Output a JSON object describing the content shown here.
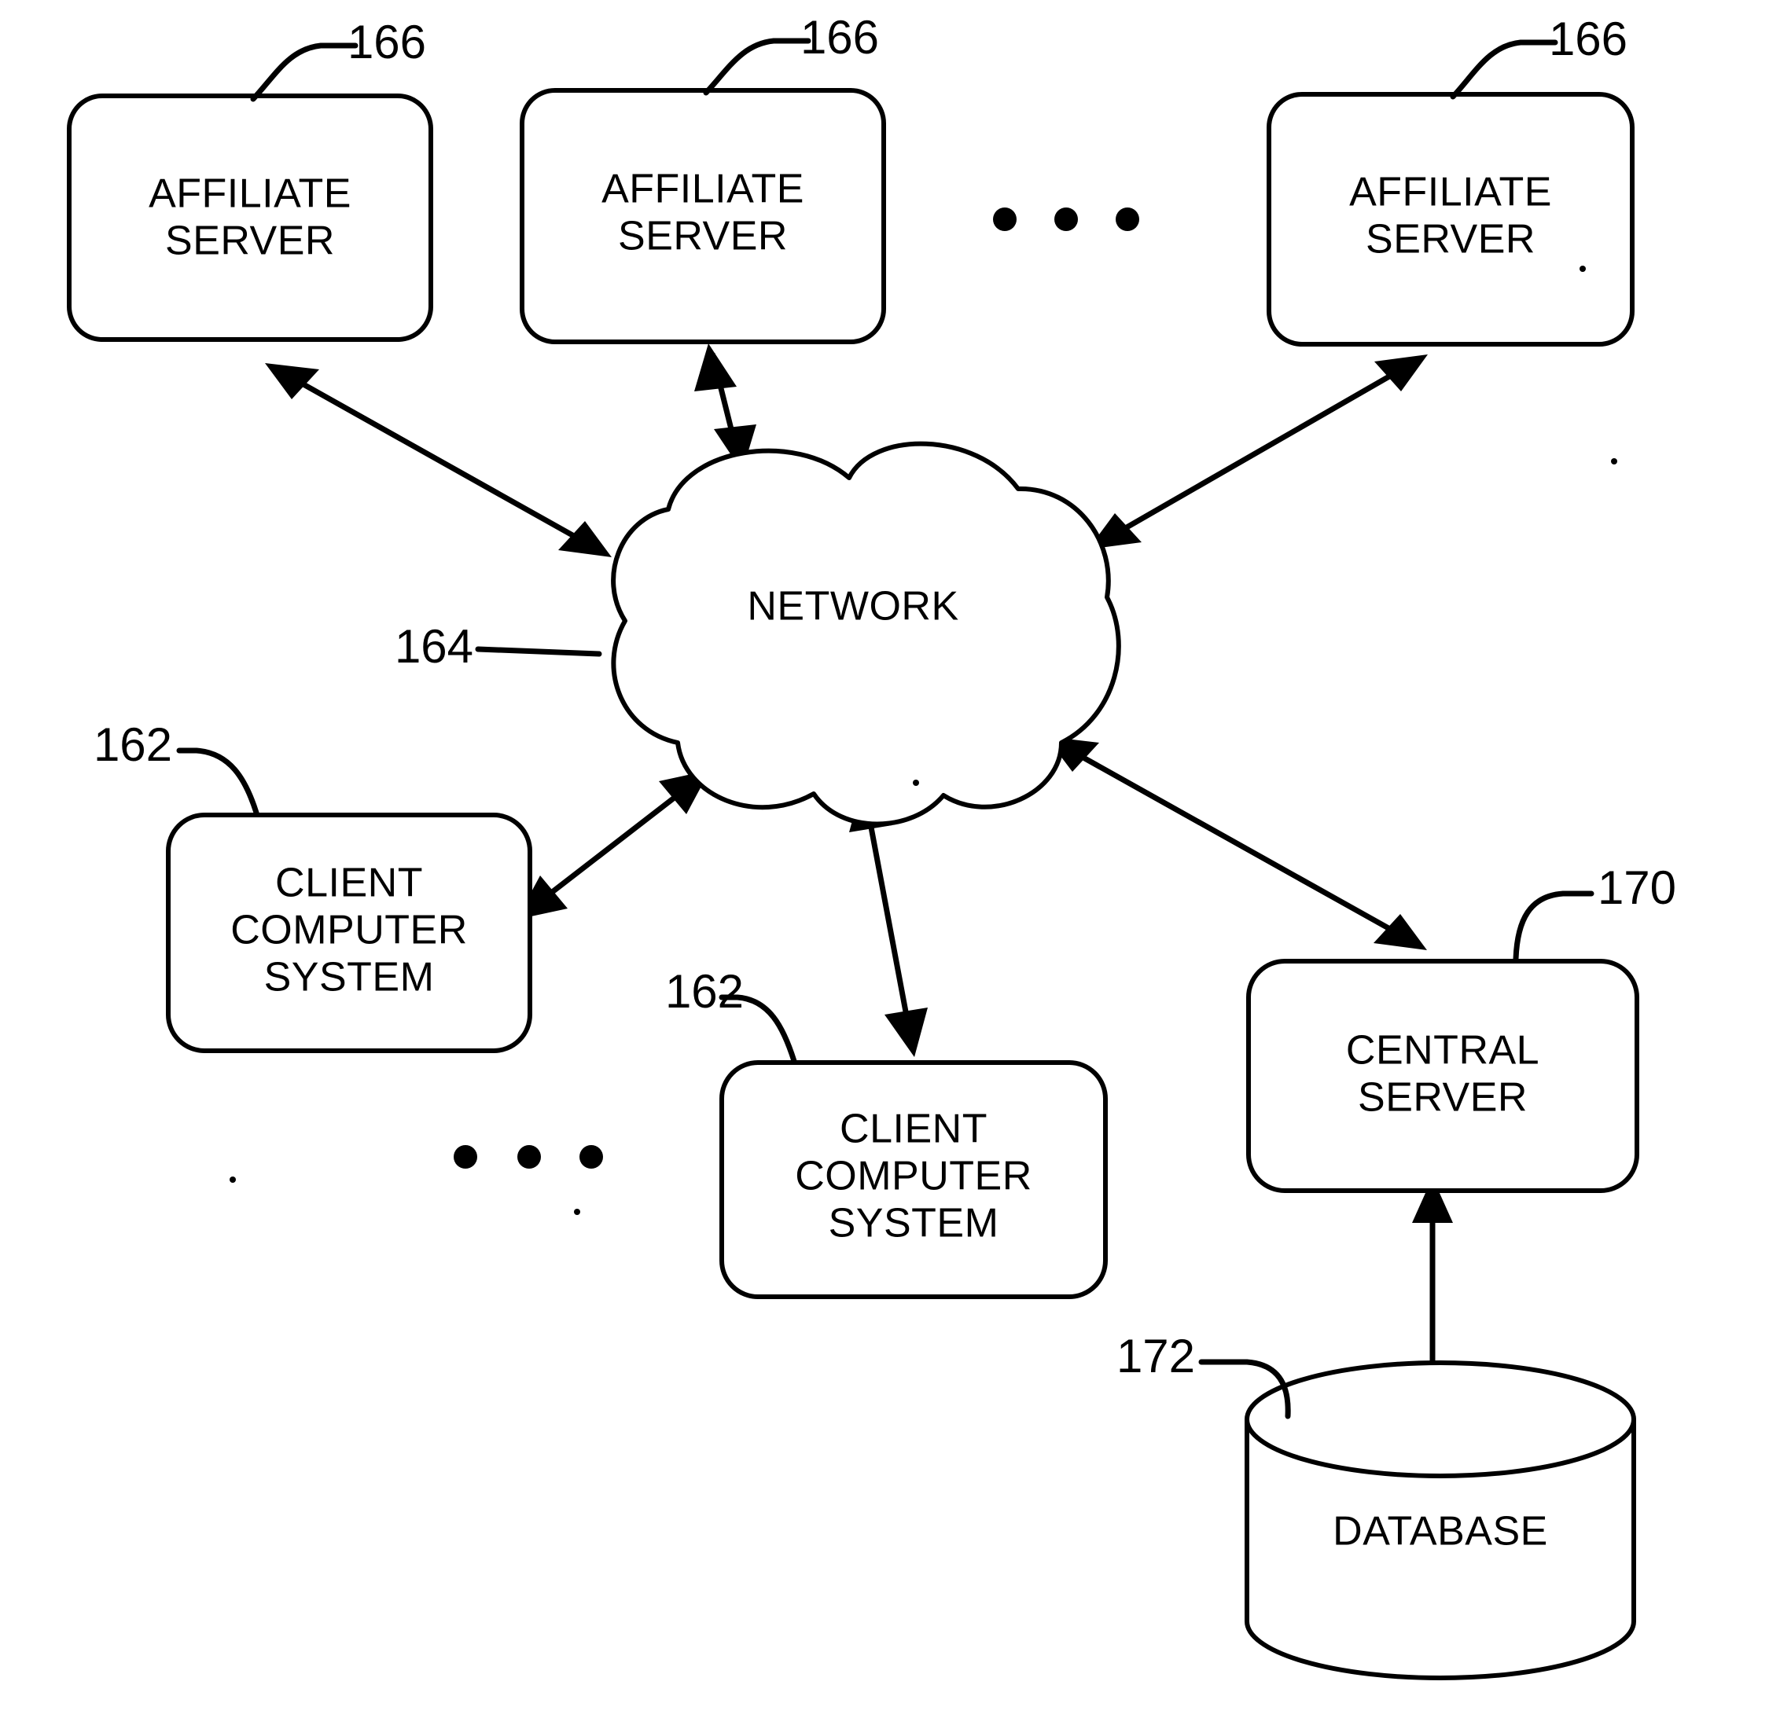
{
  "figure": {
    "type": "patent-network-diagram",
    "background_color": "#ffffff",
    "line_color": "#000000"
  },
  "nodes": {
    "affiliate_server_1": {
      "label_line1": "AFFILIATE",
      "label_line2": "SERVER",
      "ref": "166"
    },
    "affiliate_server_2": {
      "label_line1": "AFFILIATE",
      "label_line2": "SERVER",
      "ref": "166"
    },
    "affiliate_server_3": {
      "label_line1": "AFFILIATE",
      "label_line2": "SERVER",
      "ref": "166"
    },
    "network_cloud": {
      "label": "NETWORK",
      "ref": "164"
    },
    "client_computer_system_1": {
      "label_line1": "CLIENT",
      "label_line2": "COMPUTER",
      "label_line3": "SYSTEM",
      "ref": "162"
    },
    "client_computer_system_2": {
      "label_line1": "CLIENT",
      "label_line2": "COMPUTER",
      "label_line3": "SYSTEM",
      "ref": "162"
    },
    "central_server": {
      "label_line1": "CENTRAL",
      "label_line2": "SERVER",
      "ref": "170"
    },
    "database": {
      "label": "DATABASE",
      "ref": "172"
    }
  },
  "ellipses": {
    "top_row": "• • •",
    "bottom_row": "• • •"
  },
  "connections": [
    {
      "from": "affiliate_server_1",
      "to": "network_cloud",
      "arrows": "both"
    },
    {
      "from": "affiliate_server_2",
      "to": "network_cloud",
      "arrows": "both"
    },
    {
      "from": "affiliate_server_3",
      "to": "network_cloud",
      "arrows": "both"
    },
    {
      "from": "client_computer_system_1",
      "to": "network_cloud",
      "arrows": "both"
    },
    {
      "from": "client_computer_system_2",
      "to": "network_cloud",
      "arrows": "both"
    },
    {
      "from": "central_server",
      "to": "network_cloud",
      "arrows": "both"
    },
    {
      "from": "database",
      "to": "central_server",
      "arrows": "both"
    }
  ]
}
